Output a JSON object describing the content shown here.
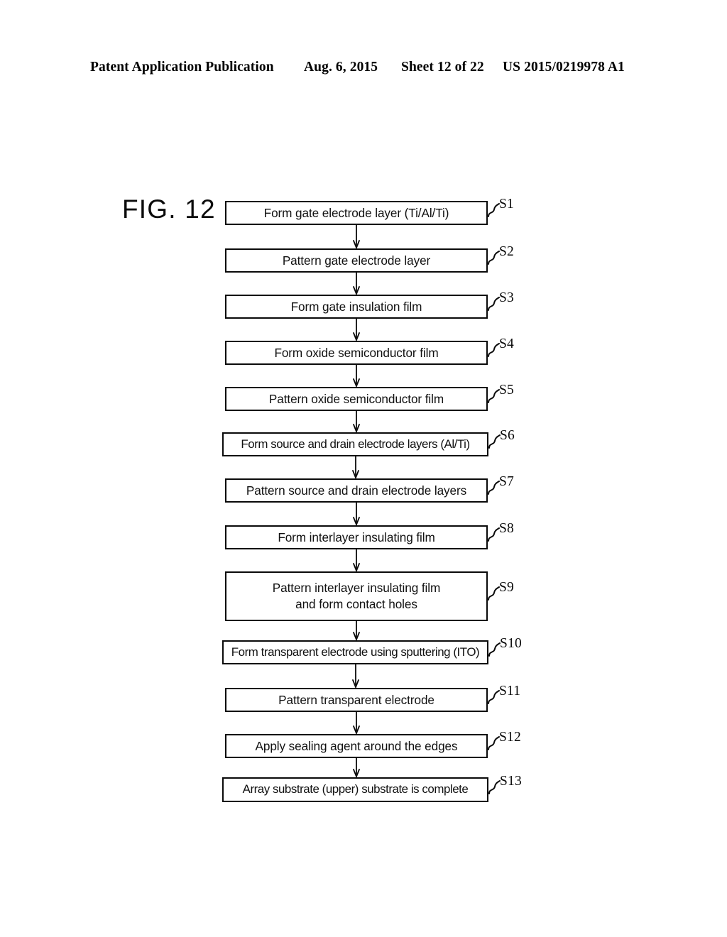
{
  "header": {
    "publication": "Patent Application Publication",
    "date": "Aug. 6, 2015",
    "sheet": "Sheet 12 of 22",
    "doc_number": "US 2015/0219978 A1"
  },
  "figure": {
    "label": "FIG. 12"
  },
  "colors": {
    "ink": "#0a0a0a",
    "paper": "#ffffff"
  },
  "flowchart": {
    "type": "flowchart",
    "orientation": "vertical-top-to-bottom",
    "connector": "single-headed-arrow",
    "steps": [
      {
        "id": "S1",
        "text": "Form gate electrode layer (Ti/Al/Ti)"
      },
      {
        "id": "S2",
        "text": "Pattern gate electrode layer"
      },
      {
        "id": "S3",
        "text": "Form gate insulation film"
      },
      {
        "id": "S4",
        "text": "Form oxide semiconductor film"
      },
      {
        "id": "S5",
        "text": "Pattern oxide semiconductor film"
      },
      {
        "id": "S6",
        "text": "Form source and drain electrode layers (Al/Ti)"
      },
      {
        "id": "S7",
        "text": "Pattern source and drain electrode layers"
      },
      {
        "id": "S8",
        "text": "Form interlayer insulating film"
      },
      {
        "id": "S9",
        "text": "Pattern interlayer insulating film\nand form contact holes"
      },
      {
        "id": "S10",
        "text": "Form transparent electrode using sputtering (ITO)"
      },
      {
        "id": "S11",
        "text": "Pattern transparent electrode"
      },
      {
        "id": "S12",
        "text": "Apply sealing agent around the edges"
      },
      {
        "id": "S13",
        "text": "Array substrate (upper) substrate is complete"
      }
    ]
  }
}
